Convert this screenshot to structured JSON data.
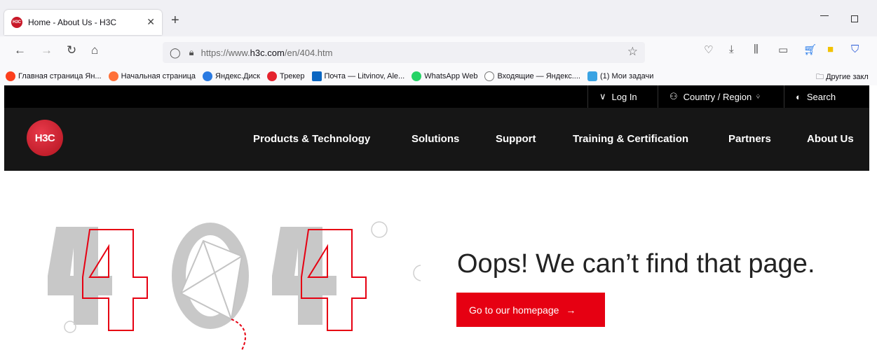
{
  "browser": {
    "tab_title": "Home - About Us - H3C",
    "tab_favicon_text": "H3C",
    "url_prefix": "https://www.",
    "url_domain": "h3c.com",
    "url_path": "/en/404.htm",
    "bookmarks": [
      {
        "label": "Главная страница Ян...",
        "color": "#fc3f1d"
      },
      {
        "label": "Начальная страница",
        "color": "#ff7139"
      },
      {
        "label": "Яндекс.Диск",
        "color": "#2a7ae2"
      },
      {
        "label": "Трекер",
        "color": "#e5232e"
      },
      {
        "label": "Почта — Litvinov, Ale...",
        "color": "#0a66c2"
      },
      {
        "label": "WhatsApp Web",
        "color": "#25d366"
      },
      {
        "label": "Входящие — Яндекс....",
        "color": "#777777"
      },
      {
        "label": "(1) Мои задачи",
        "color": "#3aa3e3"
      }
    ],
    "other_bookmarks": "Другие закл"
  },
  "site": {
    "topbar": {
      "login": "Log In",
      "region": "Country / Region",
      "search": "Search"
    },
    "logo_text": "H3C",
    "menu": [
      "Products & Technology",
      "Solutions",
      "Support",
      "Training & Certification",
      "Partners",
      "About Us"
    ],
    "error_code": "404",
    "headline": "Oops! We can’t find that page.",
    "cta_label": "Go to our homepage",
    "brand_color": "#e60012"
  }
}
